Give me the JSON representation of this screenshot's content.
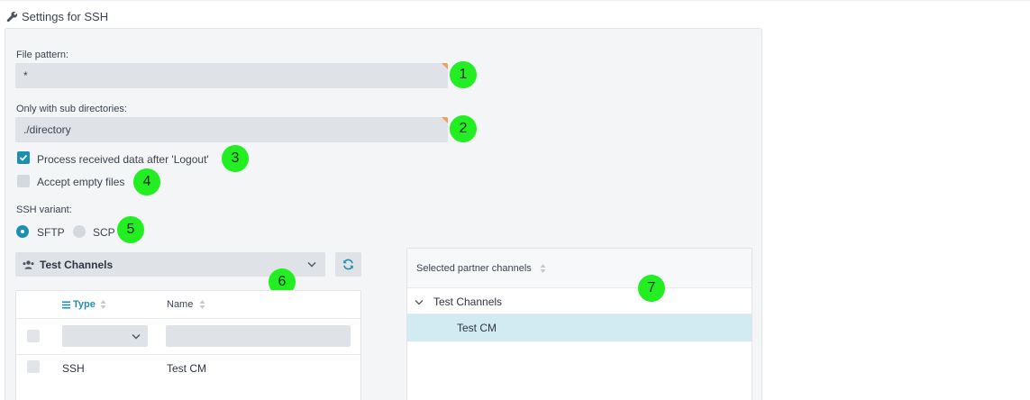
{
  "header": {
    "title": "Settings for SSH",
    "icon": "wrench-icon"
  },
  "form": {
    "file_pattern": {
      "label": "File pattern:",
      "value": "*",
      "marker": "1"
    },
    "sub_dirs": {
      "label": "Only with sub directories:",
      "value": "./directory",
      "marker": "2"
    },
    "process_after_logout": {
      "label": "Process received data after 'Logout'",
      "checked": true,
      "marker": "3"
    },
    "accept_empty": {
      "label": "Accept empty files",
      "checked": false,
      "marker": "4"
    },
    "ssh_variant": {
      "label": "SSH variant:",
      "options": [
        "SFTP",
        "SCP"
      ],
      "selected": "SFTP",
      "marker": "5"
    }
  },
  "channels_select": {
    "value": "Test Channels",
    "icon": "users-icon",
    "marker": "6"
  },
  "channel_table": {
    "columns": [
      "Type",
      "Name"
    ],
    "rows": [
      {
        "type": "SSH",
        "name": "Test CM"
      }
    ]
  },
  "partner_panel": {
    "header": "Selected partner channels",
    "group": "Test Channels",
    "selected_item": "Test CM",
    "marker": "7"
  },
  "colors": {
    "accent": "#1e8fb0",
    "marker": "#22ee22",
    "selected_row": "#d2eaf2"
  }
}
